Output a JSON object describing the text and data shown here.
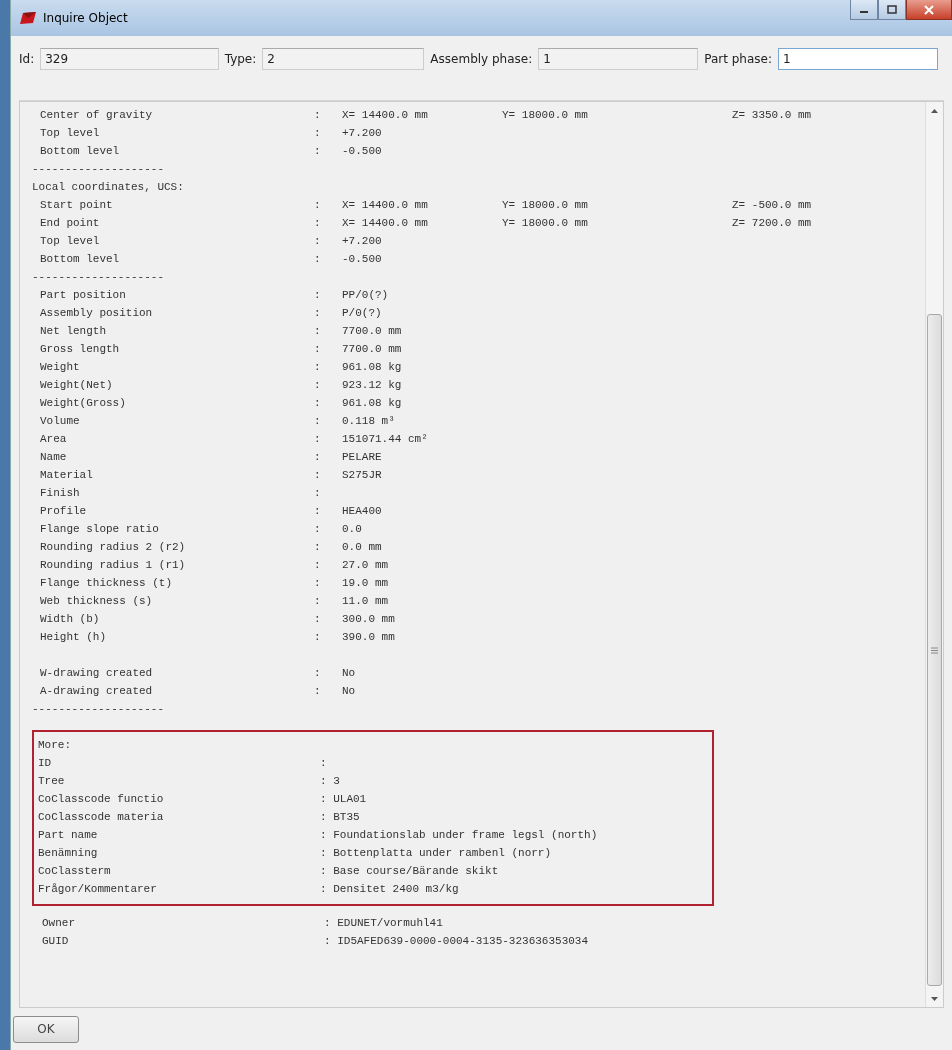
{
  "window": {
    "title": "Inquire Object"
  },
  "fields": [
    {
      "label": "Id:",
      "value": "329"
    },
    {
      "label": "Type:",
      "value": "2"
    },
    {
      "label": "Assembly phase:",
      "value": "1"
    },
    {
      "label": "Part phase:",
      "value": "1",
      "focused": true
    }
  ],
  "report": [
    {
      "kind": "row",
      "label": "Center of gravity",
      "colon": ":",
      "values": [
        "X= 14400.0 mm",
        "Y= 18000.0 mm",
        "Z= 3350.0 mm"
      ]
    },
    {
      "kind": "row",
      "label": "Top level",
      "colon": ":",
      "values": [
        "+7.200"
      ]
    },
    {
      "kind": "row",
      "label": "Bottom level",
      "colon": ":",
      "values": [
        "-0.500"
      ]
    },
    {
      "kind": "separator",
      "text": "--------------------"
    },
    {
      "kind": "heading",
      "text": "Local coordinates, UCS:"
    },
    {
      "kind": "row",
      "label": "Start point",
      "colon": ":",
      "values": [
        "X= 14400.0 mm",
        "Y= 18000.0 mm",
        "Z= -500.0 mm"
      ]
    },
    {
      "kind": "row",
      "label": "End point",
      "colon": ":",
      "values": [
        "X= 14400.0 mm",
        "Y= 18000.0 mm",
        "Z= 7200.0 mm"
      ]
    },
    {
      "kind": "row",
      "label": "Top level",
      "colon": ":",
      "values": [
        "+7.200"
      ]
    },
    {
      "kind": "row",
      "label": "Bottom level",
      "colon": ":",
      "values": [
        "-0.500"
      ]
    },
    {
      "kind": "separator",
      "text": "--------------------"
    },
    {
      "kind": "row",
      "label": "Part position",
      "colon": ":",
      "values": [
        "PP/0(?)"
      ]
    },
    {
      "kind": "row",
      "label": "Assembly position",
      "colon": ":",
      "values": [
        "P/0(?)"
      ]
    },
    {
      "kind": "row",
      "label": "Net length",
      "colon": ":",
      "values": [
        "7700.0 mm"
      ]
    },
    {
      "kind": "row",
      "label": "Gross length",
      "colon": ":",
      "values": [
        "7700.0 mm"
      ]
    },
    {
      "kind": "row",
      "label": "Weight",
      "colon": ":",
      "values": [
        "961.08 kg"
      ]
    },
    {
      "kind": "row",
      "label": "Weight(Net)",
      "colon": ":",
      "values": [
        "923.12 kg"
      ]
    },
    {
      "kind": "row",
      "label": "Weight(Gross)",
      "colon": ":",
      "values": [
        "961.08 kg"
      ]
    },
    {
      "kind": "row",
      "label": "Volume",
      "colon": ":",
      "values": [
        "0.118 m³"
      ]
    },
    {
      "kind": "row",
      "label": "Area",
      "colon": ":",
      "values": [
        "151071.44 cm²"
      ]
    },
    {
      "kind": "row",
      "label": "Name",
      "colon": ":",
      "values": [
        "PELARE"
      ]
    },
    {
      "kind": "row",
      "label": "Material",
      "colon": ":",
      "values": [
        "S275JR"
      ]
    },
    {
      "kind": "row",
      "label": "Finish",
      "colon": ":"
    },
    {
      "kind": "row",
      "label": "Profile",
      "colon": ":",
      "values": [
        "HEA400"
      ]
    },
    {
      "kind": "row",
      "label": "Flange slope ratio",
      "colon": ":",
      "values": [
        "0.0"
      ]
    },
    {
      "kind": "row",
      "label": "Rounding radius 2 (r2)",
      "colon": ":",
      "values": [
        "0.0 mm"
      ]
    },
    {
      "kind": "row",
      "label": "Rounding radius 1 (r1)",
      "colon": ":",
      "values": [
        "27.0 mm"
      ]
    },
    {
      "kind": "row",
      "label": "Flange thickness (t)",
      "colon": ":",
      "values": [
        "19.0 mm"
      ]
    },
    {
      "kind": "row",
      "label": "Web thickness (s)",
      "colon": ":",
      "values": [
        "11.0 mm"
      ]
    },
    {
      "kind": "row",
      "label": "Width (b)",
      "colon": ":",
      "values": [
        "300.0 mm"
      ]
    },
    {
      "kind": "row",
      "label": "Height (h)",
      "colon": ":",
      "values": [
        "390.0 mm"
      ]
    },
    {
      "kind": "blank"
    },
    {
      "kind": "row",
      "label": "W-drawing created",
      "colon": ":",
      "values": [
        "No"
      ]
    },
    {
      "kind": "row",
      "label": "A-drawing created",
      "colon": ":",
      "values": [
        "No"
      ]
    },
    {
      "kind": "separator",
      "text": "--------------------"
    }
  ],
  "more": {
    "title": "More:",
    "highlighted": true,
    "rows": [
      {
        "label": "ID",
        "value": ":"
      },
      {
        "label": "Tree",
        "value": ": 3"
      },
      {
        "label": "CoClasscode functio",
        "value": ": ULA01"
      },
      {
        "label": "CoClasscode materia",
        "value": ": BT35"
      },
      {
        "label": "Part name",
        "value": ": Foundationslab under frame legsl (north)"
      },
      {
        "label": "Benämning",
        "value": ": Bottenplatta under rambenl (norr)"
      },
      {
        "label": "CoClassterm",
        "value": ": Base course/Bärande skikt"
      },
      {
        "label": "Frågor/Kommentarer",
        "value": ": Densitet 2400 m3/kg"
      }
    ]
  },
  "footer_rows": [
    {
      "label": "Owner",
      "value": ": EDUNET/vormuhl41"
    },
    {
      "label": "GUID",
      "value": ": ID5AFED639-0000-0004-3135-323636353034"
    }
  ],
  "buttons": [
    "OK"
  ]
}
